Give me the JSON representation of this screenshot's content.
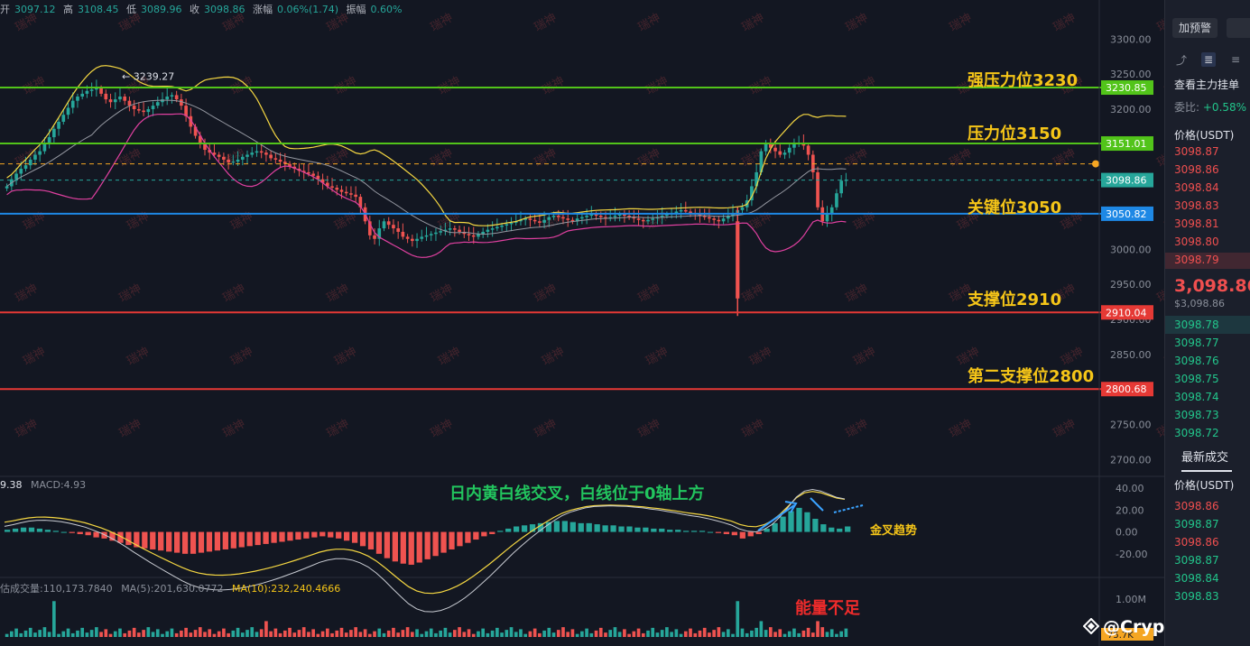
{
  "ohlc": {
    "open_label": "开",
    "open": "3097.12",
    "high_label": "高",
    "high": "3108.45",
    "low_label": "低",
    "low": "3089.96",
    "close_label": "收",
    "close": "3098.86",
    "change_label": "涨幅",
    "change": "0.06%(1.74)",
    "amp_label": "振幅",
    "amp": "0.60%"
  },
  "annotations": {
    "strong_resistance": "强压力位3230",
    "resistance": "压力位3150",
    "key": "关键位3050",
    "support": "支撑位2910",
    "second_support": "第二支撑位2800",
    "macd_note": "日内黄白线交叉，白线位于0轴上方",
    "golden_cross": "金叉趋势",
    "volume_note": "能量不足",
    "high_marker": "← 3239.27",
    "watermark_tile": "瑞神"
  },
  "macd_legend": {
    "dif": "9.38",
    "macd": "MACD:4.93"
  },
  "volume_legend": {
    "prefix": "估成交量:110,173.7840",
    "ma5": "MA(5):201,630.0772",
    "ma10": "MA(10):232,240.4666",
    "last": "75.7K"
  },
  "watermark": "@Crypto瑞神",
  "colors": {
    "up": "#26a69a",
    "down": "#ef5350",
    "green_line": "#52c41a",
    "red_line": "#e53935",
    "blue_line": "#1e88e5",
    "boll_upper": "#f5d742",
    "boll_lower": "#e040a0"
  },
  "chart_data": {
    "type": "candlestick",
    "y_axis_ticks": [
      "3300.00",
      "3250.00",
      "3200.00",
      "3150.00",
      "3100.00",
      "3050.00",
      "3000.00",
      "2950.00",
      "2900.00",
      "2850.00",
      "2800.00",
      "2750.00",
      "2700.00"
    ],
    "ylim": [
      2680,
      3330
    ],
    "horizontal_levels": [
      {
        "value": 3230.85,
        "label": "3230.85",
        "color": "#52c41a"
      },
      {
        "value": 3151.01,
        "label": "3151.01",
        "color": "#52c41a"
      },
      {
        "value": 3098.86,
        "label": "3098.86",
        "color": "#26a69a"
      },
      {
        "value": 3050.82,
        "label": "3050.82",
        "color": "#1e88e5"
      },
      {
        "value": 2910.04,
        "label": "2910.04",
        "color": "#e53935"
      },
      {
        "value": 2800.68,
        "label": "2800.68",
        "color": "#e53935"
      }
    ],
    "dashed_level": 3122,
    "close_series": [
      3090,
      3100,
      3108,
      3115,
      3120,
      3128,
      3135,
      3140,
      3150,
      3160,
      3172,
      3182,
      3192,
      3202,
      3212,
      3218,
      3222,
      3226,
      3228,
      3230,
      3222,
      3214,
      3210,
      3214,
      3218,
      3212,
      3205,
      3200,
      3198,
      3196,
      3200,
      3205,
      3210,
      3214,
      3218,
      3220,
      3214,
      3205,
      3190,
      3175,
      3162,
      3150,
      3142,
      3138,
      3135,
      3132,
      3128,
      3124,
      3125,
      3128,
      3132,
      3135,
      3138,
      3140,
      3138,
      3135,
      3130,
      3128,
      3125,
      3122,
      3118,
      3115,
      3112,
      3110,
      3108,
      3105,
      3100,
      3095,
      3090,
      3088,
      3085,
      3082,
      3080,
      3078,
      3075,
      3060,
      3040,
      3020,
      3015,
      3030,
      3040,
      3035,
      3030,
      3025,
      3018,
      3015,
      3012,
      3015,
      3018,
      3020,
      3022,
      3024,
      3026,
      3028,
      3030,
      3028,
      3025,
      3022,
      3020,
      3018,
      3022,
      3025,
      3028,
      3030,
      3032,
      3034,
      3036,
      3038,
      3040,
      3042,
      3044,
      3042,
      3040,
      3038,
      3042,
      3046,
      3048,
      3046,
      3044,
      3042,
      3040,
      3044,
      3046,
      3048,
      3050,
      3048,
      3046,
      3044,
      3046,
      3048,
      3050,
      3048,
      3046,
      3044,
      3042,
      3040,
      3042,
      3044,
      3046,
      3048,
      3050,
      3052,
      3054,
      3056,
      3054,
      3052,
      3050,
      3048,
      3046,
      3044,
      3042,
      3040,
      3044,
      3048,
      3052,
      3056,
      3060,
      3070,
      3090,
      3110,
      3140,
      3150,
      3145,
      3140,
      3135,
      3138,
      3145,
      3150,
      3152,
      3148,
      3135,
      3110,
      3060,
      3040,
      3050,
      3060,
      3080,
      3098,
      3099
    ],
    "macd_y_ticks": [
      "40.00",
      "20.00",
      "0.00",
      "-20.00"
    ],
    "macd_ylim": [
      -35,
      45
    ],
    "macd_hist": [
      2,
      3,
      4,
      4,
      3,
      2,
      1,
      0,
      -1,
      -2,
      -3,
      -5,
      -6,
      -8,
      -10,
      -12,
      -14,
      -15,
      -16,
      -17,
      -18,
      -19,
      -20,
      -20,
      -19,
      -18,
      -17,
      -16,
      -15,
      -14,
      -13,
      -12,
      -11,
      -10,
      -9,
      -8,
      -7,
      -6,
      -5,
      -4,
      -5,
      -6,
      -8,
      -10,
      -13,
      -16,
      -20,
      -24,
      -27,
      -29,
      -30,
      -28,
      -25,
      -22,
      -19,
      -16,
      -13,
      -10,
      -7,
      -4,
      -2,
      1,
      3,
      5,
      6,
      7,
      8,
      9,
      10,
      10,
      9,
      8,
      8,
      7,
      6,
      6,
      5,
      5,
      4,
      4,
      3,
      3,
      2,
      2,
      1,
      1,
      1,
      0,
      -1,
      -2,
      -3,
      -6,
      -4,
      -2,
      3,
      8,
      14,
      19,
      22,
      18,
      12,
      7,
      4,
      3,
      5
    ],
    "volume_y_ticks": [
      "1.00M"
    ],
    "volume_ylim": [
      0,
      1100000
    ]
  }
}
